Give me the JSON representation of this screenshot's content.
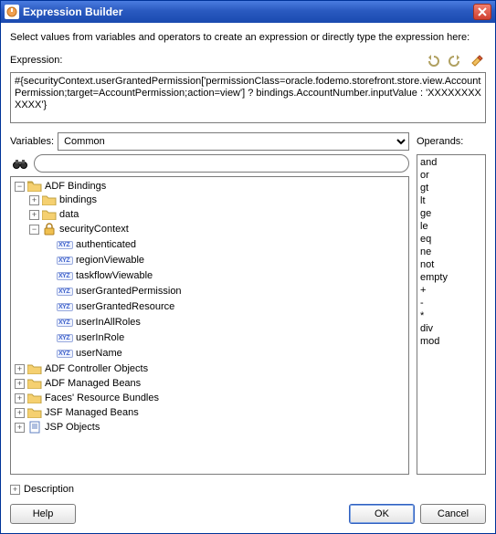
{
  "window": {
    "title": "Expression Builder"
  },
  "intro": "Select values from variables and operators to create an expression or directly type the expression here:",
  "expression": {
    "label": "Expression:",
    "value": "#{securityContext.userGrantedPermission['permissionClass=oracle.fodemo.storefront.store.view.AccountPermission;target=AccountPermission;action=view'] ? bindings.AccountNumber.inputValue : 'XXXXXXXXXXXX'}"
  },
  "variables": {
    "label": "Variables:",
    "selected": "Common",
    "options": [
      "Common"
    ]
  },
  "tree": {
    "root": "ADF Bindings",
    "root_children": [
      "bindings",
      "data",
      "securityContext"
    ],
    "securityContext_children": [
      "authenticated",
      "regionViewable",
      "taskflowViewable",
      "userGrantedPermission",
      "userGrantedResource",
      "userInAllRoles",
      "userInRole",
      "userName"
    ],
    "siblings": [
      "ADF Controller Objects",
      "ADF Managed Beans",
      "Faces' Resource Bundles",
      "JSF Managed Beans",
      "JSP Objects"
    ]
  },
  "operands": {
    "label": "Operands:",
    "items": [
      "and",
      "or",
      "gt",
      "lt",
      "ge",
      "le",
      "eq",
      "ne",
      "not",
      "empty",
      "+",
      "-",
      "*",
      "div",
      "mod"
    ]
  },
  "description": {
    "label": "Description"
  },
  "buttons": {
    "help": "Help",
    "ok": "OK",
    "cancel": "Cancel"
  }
}
